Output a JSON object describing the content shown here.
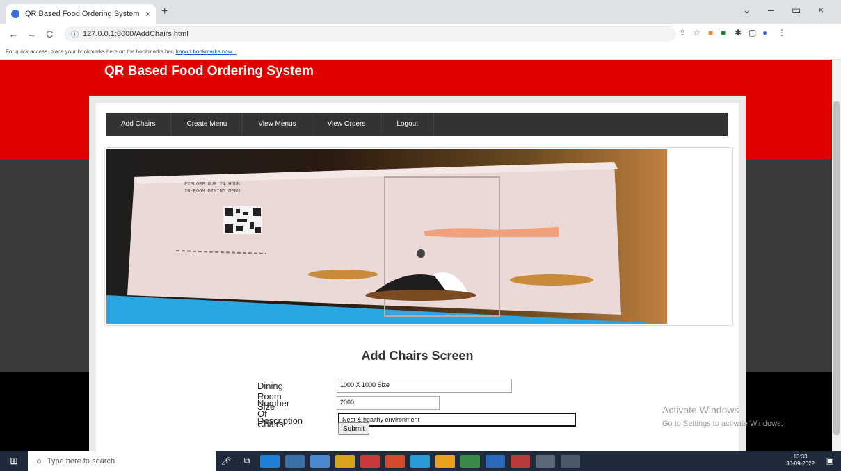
{
  "browser": {
    "tab_title": "QR Based Food Ordering System",
    "tab_close": "×",
    "new_tab": "+",
    "url": "127.0.0.1:8000/AddChairs.html",
    "bookmarks_text": "For quick access, place your bookmarks here on the bookmarks bar.",
    "bookmarks_link": "Import bookmarks now...",
    "minimize": "–",
    "maximize": "▭",
    "close": "×",
    "back": "←",
    "forward": "→",
    "reload": "C"
  },
  "site": {
    "title": "QR Based Food Ordering System"
  },
  "menu": {
    "items": [
      "Add Chairs",
      "Create Menu",
      "View Menus",
      "View Orders",
      "Logout"
    ]
  },
  "banner": {
    "text_line1": "EXPLORE OUR 24 HOUR",
    "text_line2": "IN-ROOM DINING MENU"
  },
  "form": {
    "title": "Add Chairs Screen",
    "dining_label": "Dining Room Size",
    "dining_value": "1000 X 1000 Size",
    "chairs_label": "Number Of Chairs",
    "chairs_value": "2000",
    "desc_label": "Description",
    "desc_value": "Neat & healthy environment",
    "submit_label": "Submit"
  },
  "watermark": {
    "line1": "Activate Windows",
    "line2": "Go to Settings to activate Windows."
  },
  "taskbar": {
    "search_placeholder": "Type here to search",
    "time": "13:33",
    "date": "30-09-2022"
  }
}
